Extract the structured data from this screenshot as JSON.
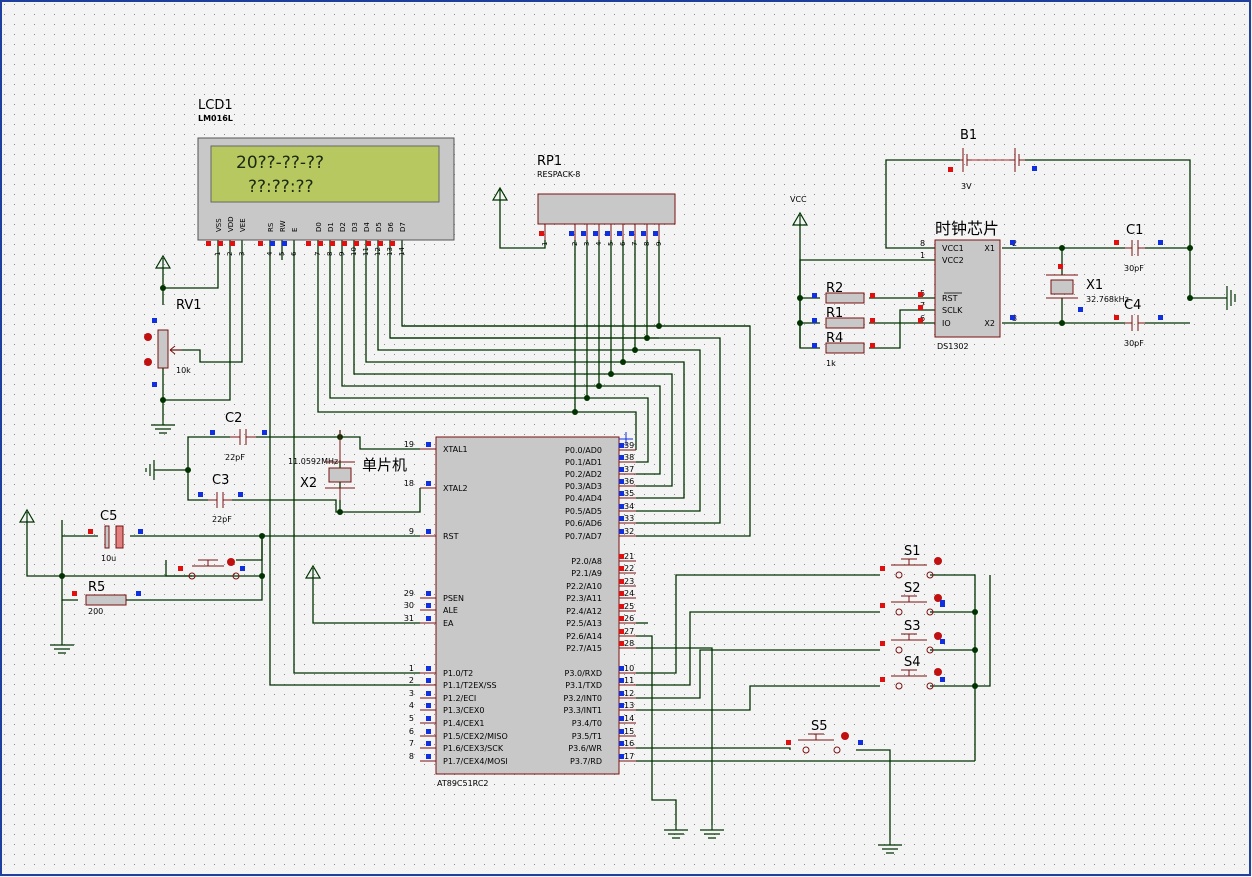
{
  "colors": {
    "background": "#f2f2f2",
    "grid_dot": "#8a8a8a",
    "wire": "#003300",
    "component": "#7a1010",
    "component_fill": "#c8c8c8",
    "lcd_bezel": "#c8c8c8",
    "lcd_screen": "#b8c860",
    "lcd_text": "#1a2a10",
    "pin_red": "#e01010",
    "pin_blue": "#1030e0",
    "label": "#000000",
    "frame": "#2040a0"
  },
  "lcd": {
    "ref": "LCD1",
    "part": "LM016L",
    "line1": "20??-??-??",
    "line2": "??:??:??",
    "pin_names": [
      "VSS",
      "VDD",
      "VEE",
      "RS",
      "RW",
      "E",
      "D0",
      "D1",
      "D2",
      "D3",
      "D4",
      "D5",
      "D6",
      "D7"
    ],
    "pin_numbers": [
      "1",
      "2",
      "3",
      "4",
      "5",
      "6",
      "7",
      "8",
      "9",
      "10",
      "11",
      "12",
      "13",
      "14"
    ]
  },
  "rp1": {
    "ref": "RP1",
    "part": "RESPACK-8",
    "pin_numbers": [
      "1",
      "2",
      "3",
      "4",
      "5",
      "6",
      "7",
      "8",
      "9"
    ]
  },
  "rv1": {
    "ref": "RV1",
    "value": "10k"
  },
  "c2": {
    "ref": "C2",
    "value": "22pF"
  },
  "c3": {
    "ref": "C3",
    "value": "22pF"
  },
  "c5": {
    "ref": "C5",
    "value": "10u"
  },
  "r5": {
    "ref": "R5",
    "value": "200"
  },
  "x2": {
    "ref": "X2",
    "value": "11.0592MHz",
    "note": "单片机"
  },
  "mcu": {
    "part": "AT89C51RC2",
    "left_pins": [
      {
        "num": "19",
        "name": "XTAL1"
      },
      {
        "num": "18",
        "name": "XTAL2"
      },
      {
        "num": "9",
        "name": "RST"
      },
      {
        "num": "29",
        "name": "PSEN"
      },
      {
        "num": "30",
        "name": "ALE"
      },
      {
        "num": "31",
        "name": "EA"
      },
      {
        "num": "1",
        "name": "P1.0/T2"
      },
      {
        "num": "2",
        "name": "P1.1/T2EX/SS"
      },
      {
        "num": "3",
        "name": "P1.2/ECI"
      },
      {
        "num": "4",
        "name": "P1.3/CEX0"
      },
      {
        "num": "5",
        "name": "P1.4/CEX1"
      },
      {
        "num": "6",
        "name": "P1.5/CEX2/MISO"
      },
      {
        "num": "7",
        "name": "P1.6/CEX3/SCK"
      },
      {
        "num": "8",
        "name": "P1.7/CEX4/MOSI"
      }
    ],
    "right_pins": [
      {
        "num": "39",
        "name": "P0.0/AD0"
      },
      {
        "num": "38",
        "name": "P0.1/AD1"
      },
      {
        "num": "37",
        "name": "P0.2/AD2"
      },
      {
        "num": "36",
        "name": "P0.3/AD3"
      },
      {
        "num": "35",
        "name": "P0.4/AD4"
      },
      {
        "num": "34",
        "name": "P0.5/AD5"
      },
      {
        "num": "33",
        "name": "P0.6/AD6"
      },
      {
        "num": "32",
        "name": "P0.7/AD7"
      },
      {
        "num": "21",
        "name": "P2.0/A8"
      },
      {
        "num": "22",
        "name": "P2.1/A9"
      },
      {
        "num": "23",
        "name": "P2.2/A10"
      },
      {
        "num": "24",
        "name": "P2.3/A11"
      },
      {
        "num": "25",
        "name": "P2.4/A12"
      },
      {
        "num": "26",
        "name": "P2.5/A13"
      },
      {
        "num": "27",
        "name": "P2.6/A14"
      },
      {
        "num": "28",
        "name": "P2.7/A15"
      },
      {
        "num": "10",
        "name": "P3.0/RXD"
      },
      {
        "num": "11",
        "name": "P3.1/TXD"
      },
      {
        "num": "12",
        "name": "P3.2/INT0"
      },
      {
        "num": "13",
        "name": "P3.3/INT1"
      },
      {
        "num": "14",
        "name": "P3.4/T0"
      },
      {
        "num": "15",
        "name": "P3.5/T1"
      },
      {
        "num": "16",
        "name": "P3.6/WR"
      },
      {
        "num": "17",
        "name": "P3.7/RD"
      }
    ]
  },
  "b1": {
    "ref": "B1",
    "value": "3V"
  },
  "vcc": {
    "label": "VCC"
  },
  "ds1302": {
    "title": "时钟芯片",
    "part": "DS1302",
    "left_pins": [
      {
        "num": "8",
        "name": "VCC1"
      },
      {
        "num": "1",
        "name": "VCC2"
      },
      {
        "num": "5",
        "name": "RST"
      },
      {
        "num": "7",
        "name": "SCLK"
      },
      {
        "num": "6",
        "name": "IO"
      }
    ],
    "right_pins": [
      {
        "num": "2",
        "name": "X1"
      },
      {
        "num": "3",
        "name": "X2"
      }
    ]
  },
  "r2": {
    "ref": "R2"
  },
  "r1": {
    "ref": "R1"
  },
  "r4": {
    "ref": "R4",
    "value": "1k"
  },
  "c1": {
    "ref": "C1",
    "value": "30pF"
  },
  "c4": {
    "ref": "C4",
    "value": "30pF"
  },
  "x1": {
    "ref": "X1",
    "value": "32.768kHz"
  },
  "switches": [
    "S1",
    "S2",
    "S3",
    "S4",
    "S5"
  ]
}
